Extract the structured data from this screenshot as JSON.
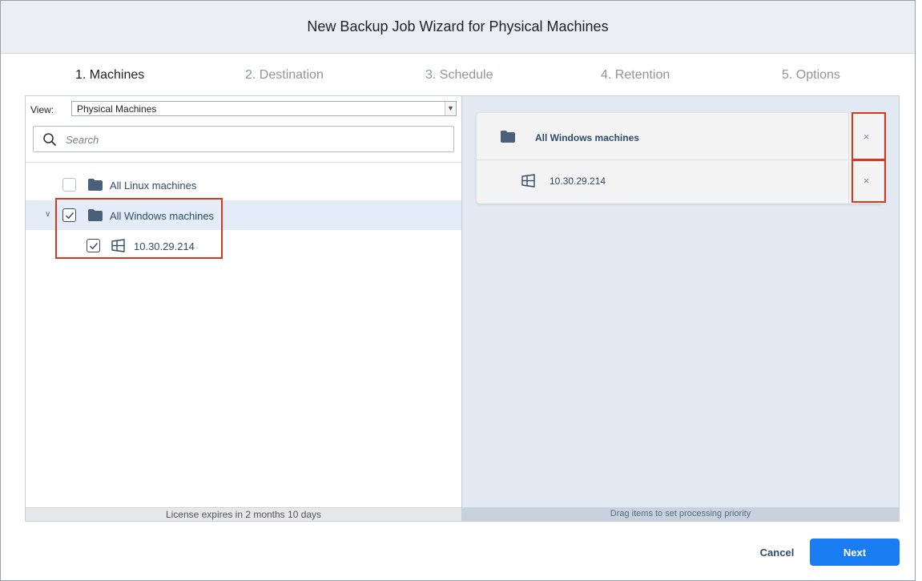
{
  "dialog": {
    "title": "New Backup Job Wizard for Physical Machines"
  },
  "steps": [
    {
      "label": "1. Machines",
      "active": true
    },
    {
      "label": "2. Destination",
      "active": false
    },
    {
      "label": "3. Schedule",
      "active": false
    },
    {
      "label": "4. Retention",
      "active": false
    },
    {
      "label": "5. Options",
      "active": false
    }
  ],
  "left_panel": {
    "view_label": "View:",
    "view_value": "Physical Machines",
    "search_placeholder": "Search",
    "tree": [
      {
        "label": "All Linux machines",
        "checked": false,
        "icon": "folder-icon"
      },
      {
        "label": "All Windows machines",
        "checked": true,
        "expanded": true,
        "icon": "folder-icon"
      },
      {
        "label": "10.30.29.214",
        "checked": true,
        "icon": "windows-icon"
      }
    ],
    "footer": "License expires in 2 months 10 days"
  },
  "right_panel": {
    "selected": [
      {
        "label": "All Windows machines",
        "icon": "folder-icon",
        "remove_glyph": "×"
      },
      {
        "label": "10.30.29.214",
        "icon": "windows-icon",
        "remove_glyph": "×"
      }
    ],
    "footer": "Drag items to set processing priority"
  },
  "buttons": {
    "cancel": "Cancel",
    "next": "Next"
  },
  "colors": {
    "accent": "#1a7cf3",
    "highlight_box": "#d9381e",
    "label_text": "#2e4c6d",
    "folder_icon": "#4a5f7c"
  }
}
